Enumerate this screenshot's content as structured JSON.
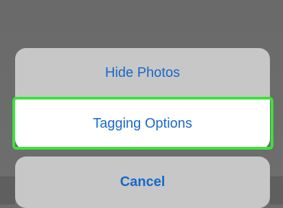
{
  "action_sheet": {
    "options": [
      {
        "label": "Hide Photos"
      },
      {
        "label": "Tagging Options"
      }
    ],
    "cancel_label": "Cancel"
  },
  "colors": {
    "accent": "#1768c9",
    "highlight": "#3ce23c",
    "sheet_bg": "#c7c7c7",
    "overlay": "#6d6d6d"
  }
}
